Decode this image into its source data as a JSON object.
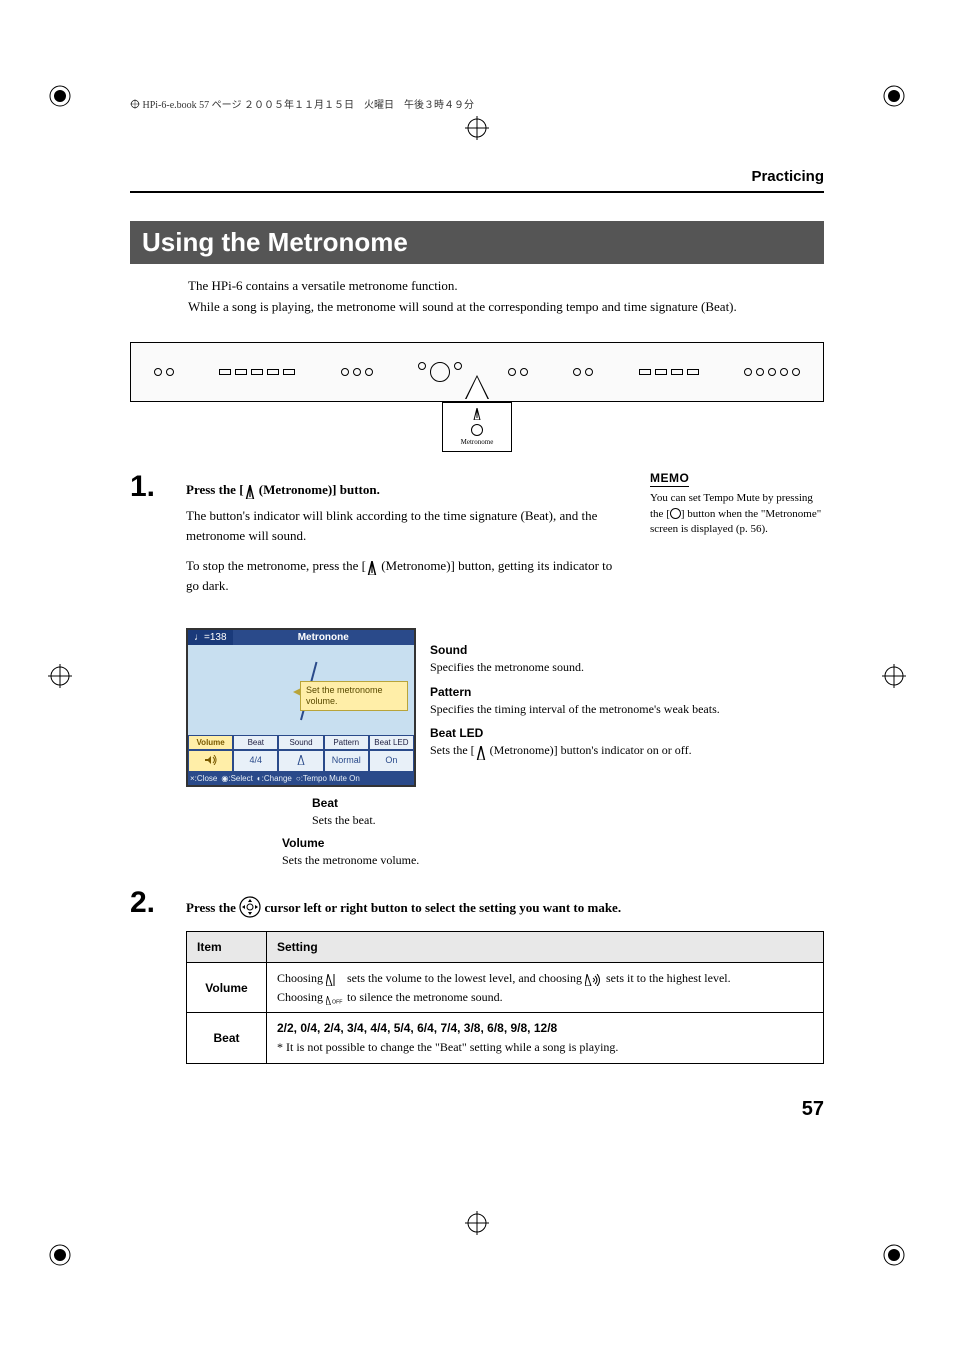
{
  "print_header": "HPi-6-e.book 57 ページ ２００５年１１月１５日　火曜日　午後３時４９分",
  "breadcrumb": "Practicing",
  "section_title": "Using the Metronome",
  "intro": {
    "line1": "The HPi-6 contains a versatile metronome function.",
    "line2": "While a song is playing, the metronome will sound at the corresponding tempo and time signature (Beat)."
  },
  "callout_label": "Metronome",
  "steps": {
    "one": {
      "num": "1.",
      "title_a": "Press the [",
      "title_b": " (Metronome)] button.",
      "body1": "The button's indicator will blink according to the time signature (Beat), and the metronome will sound.",
      "body2a": "To stop the metronome, press the [",
      "body2b": " (Metronome)] button, getting its indicator to go dark."
    },
    "two": {
      "num": "2.",
      "title_a": "Press the ",
      "title_b": " cursor left or right button to select the setting you want to make."
    }
  },
  "memo": {
    "label": "MEMO",
    "text_a": "You can set Tempo Mute by pressing the [",
    "text_b": "] button when the \"Metronome\" screen is displayed (p. 56)."
  },
  "lcd": {
    "tempo": "♩=138",
    "title": "Metronone",
    "tooltip": "Set the metronome volume.",
    "tabs": [
      "Volume",
      "Beat",
      "Sound",
      "Pattern",
      "Beat LED"
    ],
    "vals": [
      "",
      "4/4",
      "",
      "Normal",
      "On"
    ],
    "footer": {
      "close": "×:Close",
      "select": "◉:Select",
      "change": "◐:Change",
      "mute": "○:Tempo Mute On"
    }
  },
  "descs": {
    "sound": {
      "title": "Sound",
      "body": "Specifies the metronome sound."
    },
    "pattern": {
      "title": "Pattern",
      "body": "Specifies the timing interval of the metronome's weak beats."
    },
    "beatled": {
      "title": "Beat LED",
      "body_a": "Sets the [",
      "body_b": " (Metronome)] button's indicator on or off."
    }
  },
  "under": {
    "beat": {
      "title": "Beat",
      "body": "Sets the beat."
    },
    "volume": {
      "title": "Volume",
      "body": "Sets the metronome volume."
    }
  },
  "table": {
    "headers": {
      "item": "Item",
      "setting": "Setting"
    },
    "rows": {
      "volume": {
        "item": "Volume",
        "s1a": "Choosing ",
        "s1b": " sets the volume to the lowest level, and choosing ",
        "s1c": " sets it to the highest level.",
        "s2a": "Choosing ",
        "s2b": " to silence the metronome sound."
      },
      "beat": {
        "item": "Beat",
        "line1": "2/2, 0/4, 2/4, 3/4, 4/4, 5/4, 6/4, 7/4, 3/8, 6/8, 9/8, 12/8",
        "line2": "* It is not possible to change the \"Beat\" setting while a song is playing."
      }
    }
  },
  "page_num": "57"
}
